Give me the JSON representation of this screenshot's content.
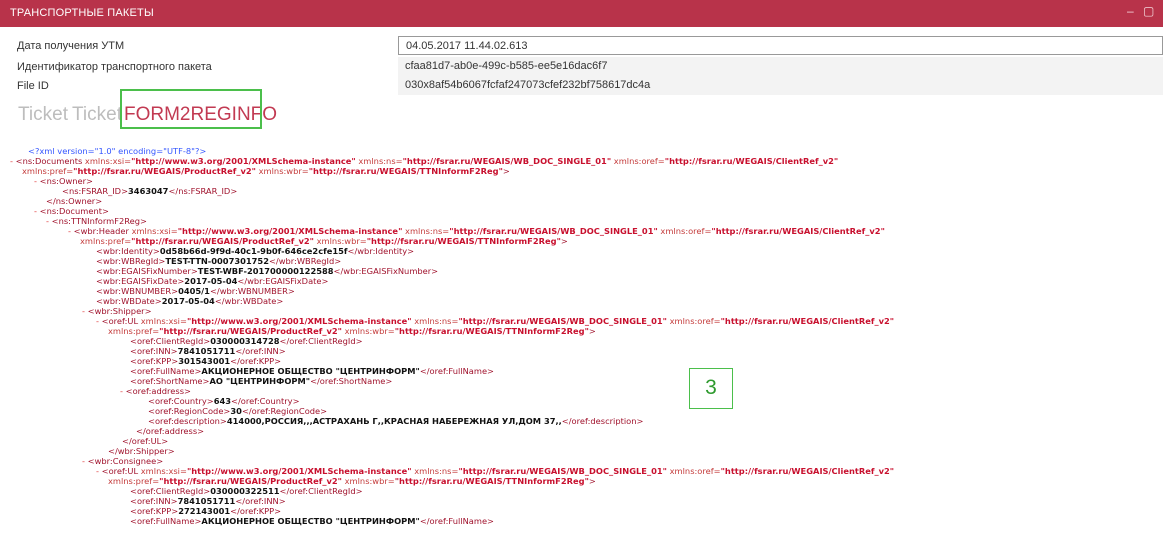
{
  "window": {
    "title": "ТРАНСПОРТНЫЕ ПАКЕТЫ",
    "minimize": "–",
    "maximize": "▢"
  },
  "fields": [
    {
      "label": "Дата получения УТМ",
      "value": "04.05.2017 11.44.02.613"
    },
    {
      "label": "Идентификатор транспортного пакета",
      "value": "cfaa81d7-ab0e-499c-b585-ee5e16dac6f7"
    },
    {
      "label": "File ID",
      "value": "030x8af54b6067fcfaf247073cfef232bf758617dc4a"
    }
  ],
  "tabs": [
    {
      "label": "Ticket",
      "active": false
    },
    {
      "label": "Ticket",
      "active": false
    },
    {
      "label": "FORM2REGINFO",
      "active": true
    }
  ],
  "annotation_badge": "3",
  "xml_lines": [
    [
      {
        "c": "pi",
        "t": "<?xml version=\"1.0\" encoding=\"UTF-8\"?>"
      }
    ],
    [
      {
        "c": "m",
        "t": "- "
      },
      {
        "c": "tg",
        "t": "<ns:Documents "
      },
      {
        "c": "an",
        "t": "xmlns:xsi="
      },
      {
        "c": "av",
        "t": "\"http://www.w3.org/2001/XMLSchema-instance\""
      },
      {
        "c": "an",
        "t": " xmlns:ns="
      },
      {
        "c": "av",
        "t": "\"http://fsrar.ru/WEGAIS/WB_DOC_SINGLE_01\""
      },
      {
        "c": "an",
        "t": " xmlns:oref="
      },
      {
        "c": "av",
        "t": "\"http://fsrar.ru/WEGAIS/ClientRef_v2\""
      }
    ],
    [
      {
        "c": "an",
        "t": "xmlns:pref="
      },
      {
        "c": "av",
        "t": "\"http://fsrar.ru/WEGAIS/ProductRef_v2\""
      },
      {
        "c": "an",
        "t": " xmlns:wbr="
      },
      {
        "c": "av",
        "t": "\"http://fsrar.ru/WEGAIS/TTNInformF2Reg\""
      },
      {
        "c": "tg",
        "t": ">"
      }
    ],
    [
      {
        "c": "m",
        "t": "- "
      },
      {
        "c": "tg",
        "t": "<ns:Owner>"
      }
    ],
    [
      {
        "c": "tg",
        "t": "<ns:FSRAR_ID>"
      },
      {
        "c": "tx",
        "t": "3463047"
      },
      {
        "c": "tg",
        "t": "</ns:FSRAR_ID>"
      }
    ],
    [
      {
        "c": "tg",
        "t": "</ns:Owner>"
      }
    ],
    [
      {
        "c": "m",
        "t": "- "
      },
      {
        "c": "tg",
        "t": "<ns:Document>"
      }
    ],
    [
      {
        "c": "m",
        "t": "- "
      },
      {
        "c": "tg",
        "t": "<ns:TTNInformF2Reg>"
      }
    ],
    [
      {
        "c": "m",
        "t": "- "
      },
      {
        "c": "tg",
        "t": "<wbr:Header "
      },
      {
        "c": "an",
        "t": "xmlns:xsi="
      },
      {
        "c": "av",
        "t": "\"http://www.w3.org/2001/XMLSchema-instance\""
      },
      {
        "c": "an",
        "t": " xmlns:ns="
      },
      {
        "c": "av",
        "t": "\"http://fsrar.ru/WEGAIS/WB_DOC_SINGLE_01\""
      },
      {
        "c": "an",
        "t": " xmlns:oref="
      },
      {
        "c": "av",
        "t": "\"http://fsrar.ru/WEGAIS/ClientRef_v2\""
      }
    ],
    [
      {
        "c": "an",
        "t": "xmlns:pref="
      },
      {
        "c": "av",
        "t": "\"http://fsrar.ru/WEGAIS/ProductRef_v2\""
      },
      {
        "c": "an",
        "t": " xmlns:wbr="
      },
      {
        "c": "av",
        "t": "\"http://fsrar.ru/WEGAIS/TTNInformF2Reg\""
      },
      {
        "c": "tg",
        "t": ">"
      }
    ],
    [
      {
        "c": "tg",
        "t": "<wbr:Identity>"
      },
      {
        "c": "tx",
        "t": "0d58b66d-9f9d-40c1-9b0f-646ce2cfe15f"
      },
      {
        "c": "tg",
        "t": "</wbr:Identity>"
      }
    ],
    [
      {
        "c": "tg",
        "t": "<wbr:WBRegId>"
      },
      {
        "c": "tx",
        "t": "TEST-TTN-0007301752"
      },
      {
        "c": "tg",
        "t": "</wbr:WBRegId>"
      }
    ],
    [
      {
        "c": "tg",
        "t": "<wbr:EGAISFixNumber>"
      },
      {
        "c": "tx",
        "t": "TEST-WBF-201700000122588"
      },
      {
        "c": "tg",
        "t": "</wbr:EGAISFixNumber>"
      }
    ],
    [
      {
        "c": "tg",
        "t": "<wbr:EGAISFixDate>"
      },
      {
        "c": "tx",
        "t": "2017-05-04"
      },
      {
        "c": "tg",
        "t": "</wbr:EGAISFixDate>"
      }
    ],
    [
      {
        "c": "tg",
        "t": "<wbr:WBNUMBER>"
      },
      {
        "c": "tx",
        "t": "0405/1"
      },
      {
        "c": "tg",
        "t": "</wbr:WBNUMBER>"
      }
    ],
    [
      {
        "c": "tg",
        "t": "<wbr:WBDate>"
      },
      {
        "c": "tx",
        "t": "2017-05-04"
      },
      {
        "c": "tg",
        "t": "</wbr:WBDate>"
      }
    ],
    [
      {
        "c": "m",
        "t": "- "
      },
      {
        "c": "tg",
        "t": "<wbr:Shipper>"
      }
    ],
    [
      {
        "c": "m",
        "t": "- "
      },
      {
        "c": "tg",
        "t": "<oref:UL "
      },
      {
        "c": "an",
        "t": "xmlns:xsi="
      },
      {
        "c": "av",
        "t": "\"http://www.w3.org/2001/XMLSchema-instance\""
      },
      {
        "c": "an",
        "t": " xmlns:ns="
      },
      {
        "c": "av",
        "t": "\"http://fsrar.ru/WEGAIS/WB_DOC_SINGLE_01\""
      },
      {
        "c": "an",
        "t": " xmlns:oref="
      },
      {
        "c": "av",
        "t": "\"http://fsrar.ru/WEGAIS/ClientRef_v2\""
      }
    ],
    [
      {
        "c": "an",
        "t": "xmlns:pref="
      },
      {
        "c": "av",
        "t": "\"http://fsrar.ru/WEGAIS/ProductRef_v2\""
      },
      {
        "c": "an",
        "t": " xmlns:wbr="
      },
      {
        "c": "av",
        "t": "\"http://fsrar.ru/WEGAIS/TTNInformF2Reg\""
      },
      {
        "c": "tg",
        "t": ">"
      }
    ],
    [
      {
        "c": "tg",
        "t": "<oref:ClientRegId>"
      },
      {
        "c": "tx",
        "t": "030000314728"
      },
      {
        "c": "tg",
        "t": "</oref:ClientRegId>"
      }
    ],
    [
      {
        "c": "tg",
        "t": "<oref:INN>"
      },
      {
        "c": "tx",
        "t": "7841051711"
      },
      {
        "c": "tg",
        "t": "</oref:INN>"
      }
    ],
    [
      {
        "c": "tg",
        "t": "<oref:KPP>"
      },
      {
        "c": "tx",
        "t": "301543001"
      },
      {
        "c": "tg",
        "t": "</oref:KPP>"
      }
    ],
    [
      {
        "c": "tg",
        "t": "<oref:FullName>"
      },
      {
        "c": "tx",
        "t": "АКЦИОНЕРНОЕ ОБЩЕСТВО \"ЦЕНТРИНФОРМ\""
      },
      {
        "c": "tg",
        "t": "</oref:FullName>"
      }
    ],
    [
      {
        "c": "tg",
        "t": "<oref:ShortName>"
      },
      {
        "c": "tx",
        "t": "АО \"ЦЕНТРИНФОРМ\""
      },
      {
        "c": "tg",
        "t": "</oref:ShortName>"
      }
    ],
    [
      {
        "c": "m",
        "t": "- "
      },
      {
        "c": "tg",
        "t": "<oref:address>"
      }
    ],
    [
      {
        "c": "tg",
        "t": "<oref:Country>"
      },
      {
        "c": "tx",
        "t": "643"
      },
      {
        "c": "tg",
        "t": "</oref:Country>"
      }
    ],
    [
      {
        "c": "tg",
        "t": "<oref:RegionCode>"
      },
      {
        "c": "tx",
        "t": "30"
      },
      {
        "c": "tg",
        "t": "</oref:RegionCode>"
      }
    ],
    [
      {
        "c": "tg",
        "t": "<oref:description>"
      },
      {
        "c": "tx",
        "t": "414000,РОССИЯ,,,АСТРАХАНЬ Г,,КРАСНАЯ НАБЕРЕЖНАЯ УЛ,ДОМ 37,,"
      },
      {
        "c": "tg",
        "t": "</oref:description>"
      }
    ],
    [
      {
        "c": "tg",
        "t": "</oref:address>"
      }
    ],
    [
      {
        "c": "tg",
        "t": "</oref:UL>"
      }
    ],
    [
      {
        "c": "tg",
        "t": "</wbr:Shipper>"
      }
    ],
    [
      {
        "c": "m",
        "t": "- "
      },
      {
        "c": "tg",
        "t": "<wbr:Consignee>"
      }
    ],
    [
      {
        "c": "m",
        "t": "- "
      },
      {
        "c": "tg",
        "t": "<oref:UL "
      },
      {
        "c": "an",
        "t": "xmlns:xsi="
      },
      {
        "c": "av",
        "t": "\"http://www.w3.org/2001/XMLSchema-instance\""
      },
      {
        "c": "an",
        "t": " xmlns:ns="
      },
      {
        "c": "av",
        "t": "\"http://fsrar.ru/WEGAIS/WB_DOC_SINGLE_01\""
      },
      {
        "c": "an",
        "t": " xmlns:oref="
      },
      {
        "c": "av",
        "t": "\"http://fsrar.ru/WEGAIS/ClientRef_v2\""
      }
    ],
    [
      {
        "c": "an",
        "t": "xmlns:pref="
      },
      {
        "c": "av",
        "t": "\"http://fsrar.ru/WEGAIS/ProductRef_v2\""
      },
      {
        "c": "an",
        "t": " xmlns:wbr="
      },
      {
        "c": "av",
        "t": "\"http://fsrar.ru/WEGAIS/TTNInformF2Reg\""
      },
      {
        "c": "tg",
        "t": ">"
      }
    ],
    [
      {
        "c": "tg",
        "t": "<oref:ClientRegId>"
      },
      {
        "c": "tx",
        "t": "030000322511"
      },
      {
        "c": "tg",
        "t": "</oref:ClientRegId>"
      }
    ],
    [
      {
        "c": "tg",
        "t": "<oref:INN>"
      },
      {
        "c": "tx",
        "t": "7841051711"
      },
      {
        "c": "tg",
        "t": "</oref:INN>"
      }
    ],
    [
      {
        "c": "tg",
        "t": "<oref:KPP>"
      },
      {
        "c": "tx",
        "t": "272143001"
      },
      {
        "c": "tg",
        "t": "</oref:KPP>"
      }
    ],
    [
      {
        "c": "tg",
        "t": "<oref:FullName>"
      },
      {
        "c": "tx",
        "t": "АКЦИОНЕРНОЕ ОБЩЕСТВО \"ЦЕНТРИНФОРМ\""
      },
      {
        "c": "tg",
        "t": "</oref:FullName>"
      }
    ]
  ]
}
